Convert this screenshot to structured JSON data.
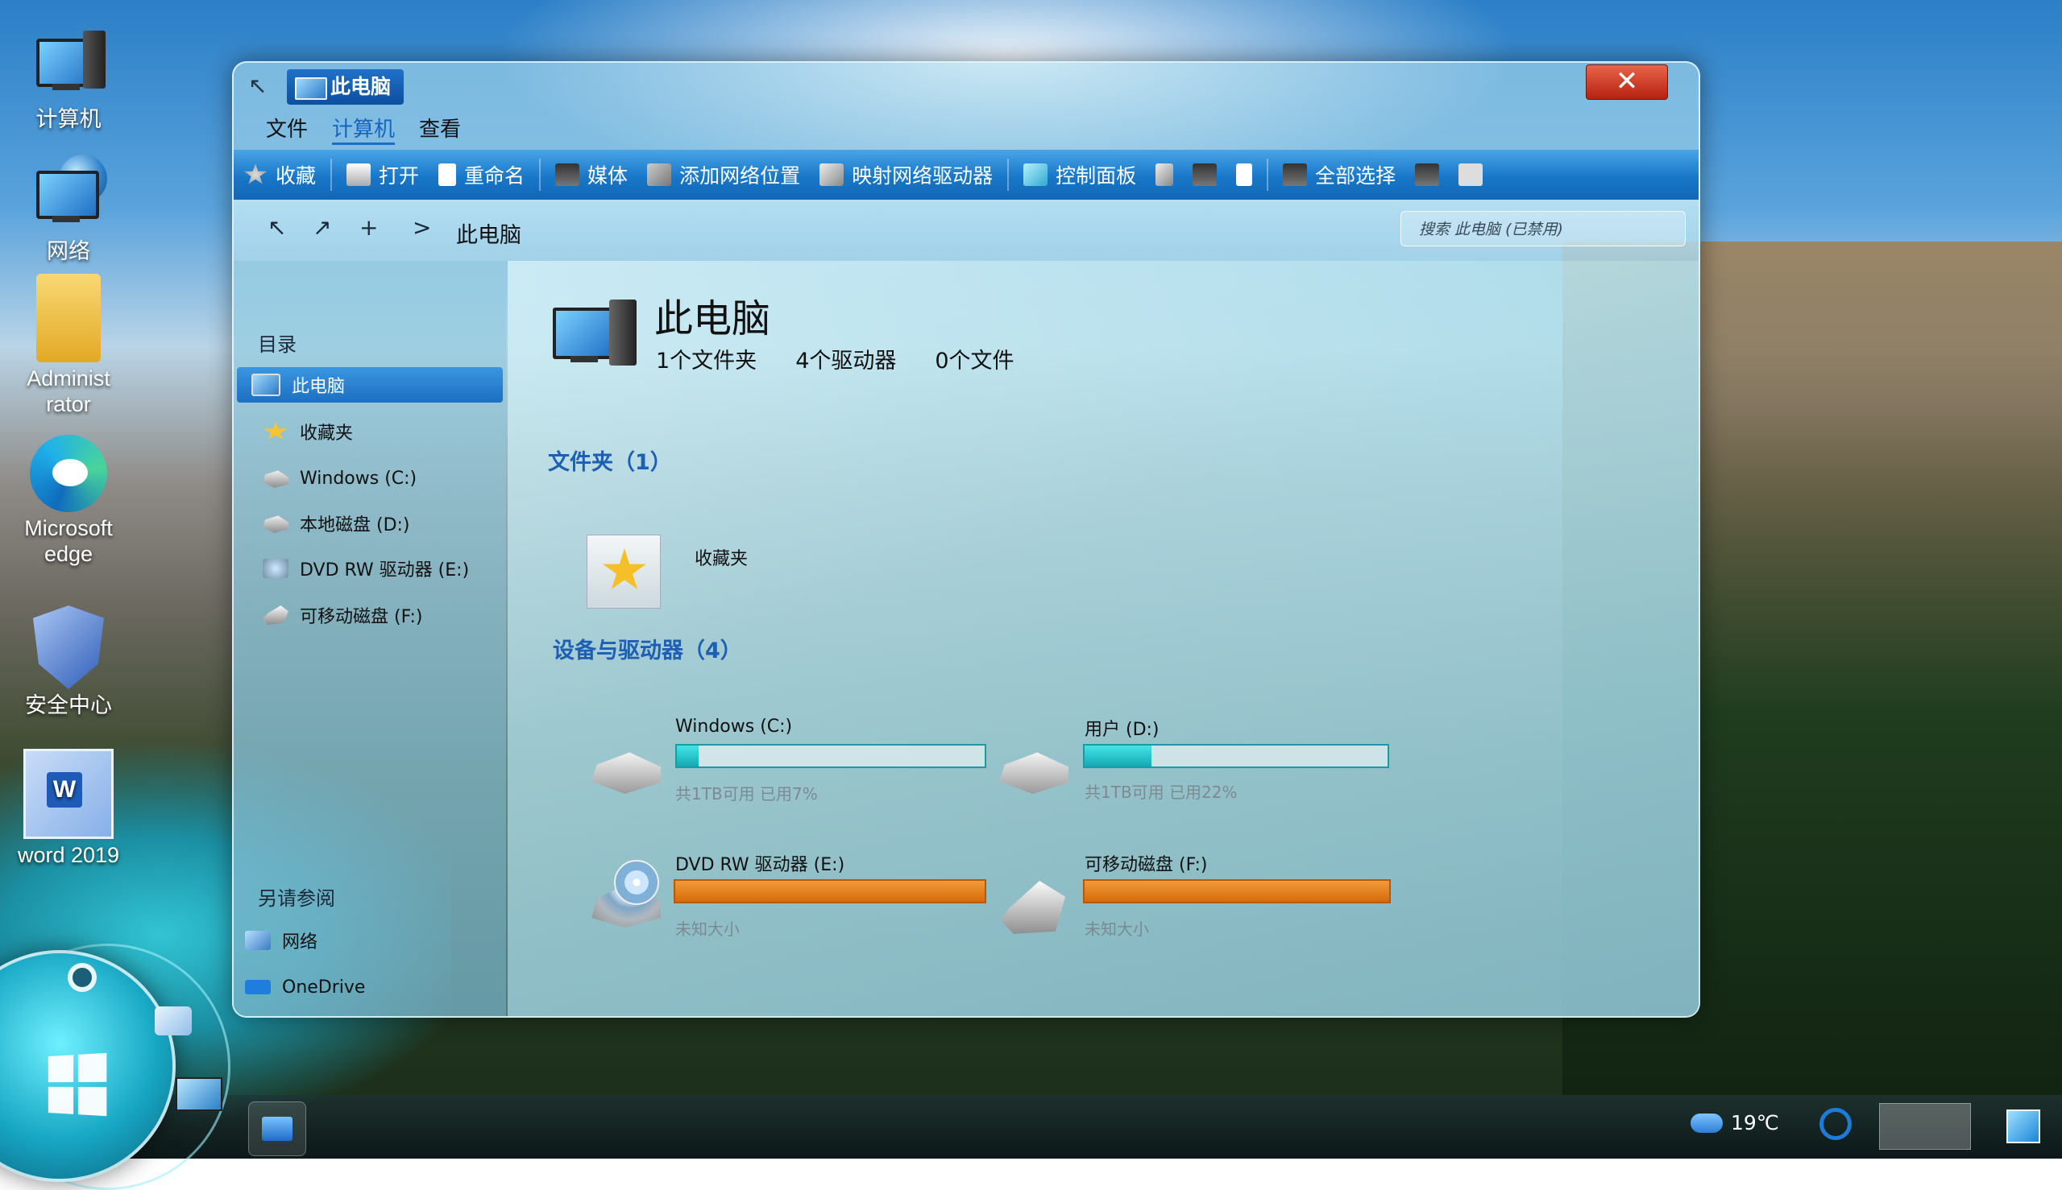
{
  "desktop": {
    "icons": [
      {
        "label": "计算机",
        "icon": "computer-icon"
      },
      {
        "label": "网络",
        "icon": "network-icon"
      },
      {
        "label": "Administrator",
        "label_line1": "Administ",
        "label_line2": "rator",
        "icon": "user-folder-icon"
      },
      {
        "label": "Microsoft edge",
        "label_line1": "Microsoft",
        "label_line2": "edge",
        "icon": "edge-icon"
      },
      {
        "label": "安全中心",
        "icon": "security-shield-icon"
      },
      {
        "label": "word 2019",
        "icon": "word-icon"
      }
    ]
  },
  "window": {
    "title": "此电脑",
    "close_label": "✕",
    "menu": [
      {
        "label": "文件",
        "active": false
      },
      {
        "label": "计算机",
        "active": true
      },
      {
        "label": "查看",
        "active": false
      }
    ],
    "toolbar": {
      "favorites": "收藏",
      "open": "打开",
      "rename": "重命名",
      "media": "媒体",
      "add_network_location": "添加网络位置",
      "map_network_drive": "映射网络驱动器",
      "control_panel": "控制面板",
      "select_all": "全部选择"
    },
    "address": {
      "path": "此电脑",
      "search_placeholder": "搜索 此电脑   (已禁用)"
    },
    "sidebar": {
      "section_catalog": "目录",
      "items": [
        {
          "label": "此电脑",
          "icon": "pc-icon",
          "selected": true
        },
        {
          "label": "收藏夹",
          "icon": "star-icon"
        },
        {
          "label": "Windows (C:)",
          "icon": "drive-icon"
        },
        {
          "label": "本地磁盘 (D:)",
          "icon": "drive-icon"
        },
        {
          "label": "DVD RW 驱动器 (E:)",
          "icon": "dvd-icon"
        },
        {
          "label": "可移动磁盘 (F:)",
          "icon": "usb-icon"
        }
      ],
      "section_see_also": "另请参阅",
      "see_also": [
        {
          "label": "网络",
          "icon": "network-icon"
        },
        {
          "label": "OneDrive",
          "icon": "onedrive-icon"
        }
      ]
    },
    "content": {
      "title": "此电脑",
      "stats": {
        "folders": "1个文件夹",
        "drives": "4个驱动器",
        "files": "0个文件"
      },
      "folders_header": "文件夹（1）",
      "folders": [
        {
          "label": "收藏夹",
          "icon": "favorites-star-icon"
        }
      ],
      "devices_header": "设备与驱动器（4）",
      "drives": [
        {
          "name": "Windows (C:)",
          "info": "共1TB可用    已用7%",
          "used_pct": 7,
          "icon": "hard-drive-icon"
        },
        {
          "name": "用户 (D:)",
          "info": "共1TB可用    已用22%",
          "used_pct": 22,
          "icon": "hard-drive-icon"
        },
        {
          "name": "DVD RW 驱动器 (E:)",
          "info": "未知大小",
          "used_pct": null,
          "icon": "dvd-drive-icon"
        },
        {
          "name": "可移动磁盘 (F:)",
          "info": "未知大小",
          "used_pct": null,
          "icon": "usb-drive-icon"
        }
      ]
    }
  },
  "taskbar": {
    "weather": "19℃"
  },
  "colors": {
    "accent": "#1b6dc7",
    "usage_bar": "#13a9b3",
    "unknown_bar": "#d66a0a",
    "close": "#c8301a"
  }
}
